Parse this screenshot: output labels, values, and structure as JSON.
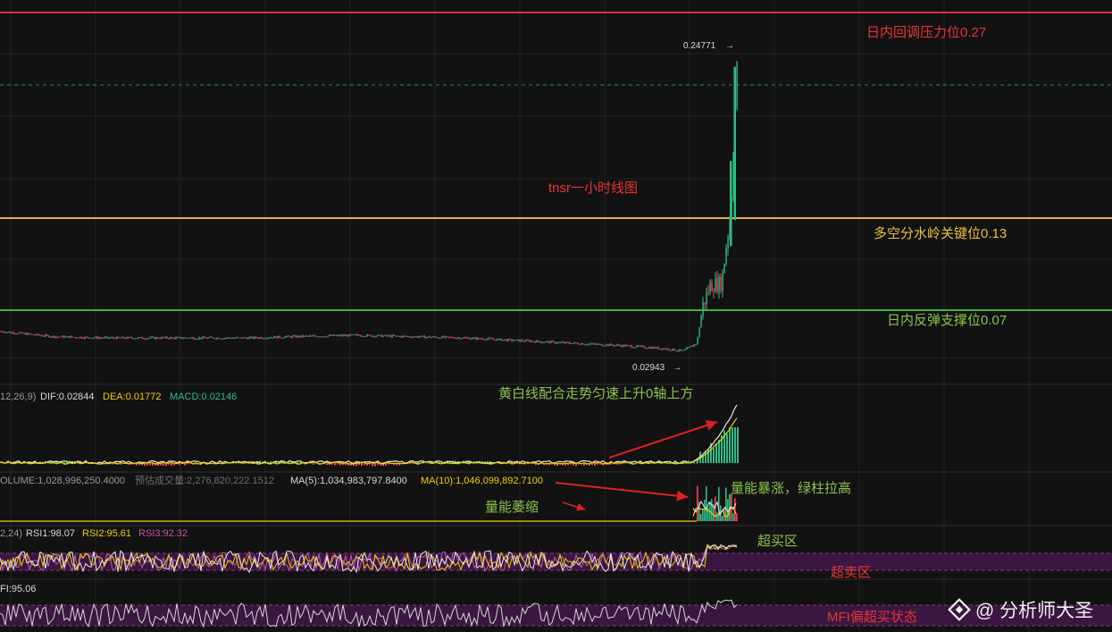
{
  "colors": {
    "background": "#121212",
    "grid": "#232323",
    "pane_separator": "#2e2e2e",
    "candle_up": "#2ebd85",
    "candle_down": "#f6465d",
    "resistance_line": "#e02f2f",
    "key_line": "#e6b43c",
    "support_line": "#3fb53f",
    "dashed_level": "#1f8c6e",
    "annotation_red": "#e83535",
    "annotation_yellow": "#e8c23c",
    "annotation_green": "#8bc34a",
    "arrow_red": "#e02020",
    "dif_line": "#e8e8e8",
    "dea_line": "#f0d000",
    "macd_label": "#2ebd85",
    "rsi1": "#e8e8e8",
    "rsi2": "#f0d000",
    "rsi3": "#c05ab0",
    "zone_fill": "#3a1640",
    "mfi_line": "#d8d8d8"
  },
  "chart_data": {
    "type": "candlestick",
    "title": "tnsr一小时线图",
    "price_marks": {
      "high": "0.24771",
      "low": "0.02943"
    },
    "price_series_approx": [
      [
        0,
        0.045
      ],
      [
        60,
        0.041
      ],
      [
        120,
        0.04
      ],
      [
        200,
        0.04
      ],
      [
        280,
        0.04
      ],
      [
        330,
        0.041
      ],
      [
        400,
        0.042
      ],
      [
        460,
        0.041
      ],
      [
        520,
        0.04
      ],
      [
        580,
        0.038
      ],
      [
        640,
        0.036
      ],
      [
        700,
        0.034
      ],
      [
        740,
        0.032
      ],
      [
        765,
        0.03
      ],
      [
        772,
        0.033
      ],
      [
        780,
        0.036
      ],
      [
        787,
        0.065
      ],
      [
        795,
        0.08
      ],
      [
        808,
        0.082
      ],
      [
        813,
        0.11
      ],
      [
        818,
        0.135
      ],
      [
        822,
        0.2
      ],
      [
        825,
        0.247
      ]
    ],
    "levels": [
      {
        "name": "resistance",
        "label": "日内回调压力位0.27",
        "value": 0.27,
        "color": "#e02f2f"
      },
      {
        "name": "key",
        "label": "多空分水岭关键位0.13",
        "value": 0.13,
        "color": "#e6b43c"
      },
      {
        "name": "support",
        "label": "日内反弹支撑位0.07",
        "value": 0.07,
        "color": "#3fb53f"
      }
    ],
    "indicators": {
      "macd": {
        "prefix": "12,26,9)",
        "dif": "DIF:0.02844",
        "dea": "DEA:0.01772",
        "macd": "MACD:0.02146",
        "note": "黄白线配合走势匀速上升0轴上方"
      },
      "volume": {
        "volume": "OLUME:1,028,996,250.4000",
        "est": "预估成交量:2,276,820,222.1512",
        "ma5": "MA(5):1,034,983,797.8400",
        "ma10": "MA(10):1,046,099,892.7100",
        "note_shrink": "量能萎缩",
        "note_surge": "量能暴涨，绿柱拉高"
      },
      "rsi": {
        "prefix": "2,24)",
        "rsi1": "RSI1:98.07",
        "rsi2": "RSI2:95.61",
        "rsi3": "RSI3:92.32",
        "overbought": "超买区",
        "oversold": "超卖区"
      },
      "mfi": {
        "value": "FI:95.06",
        "note": "MFI偏超买状态"
      }
    }
  },
  "watermark": {
    "text": "@ 分析师大圣"
  }
}
